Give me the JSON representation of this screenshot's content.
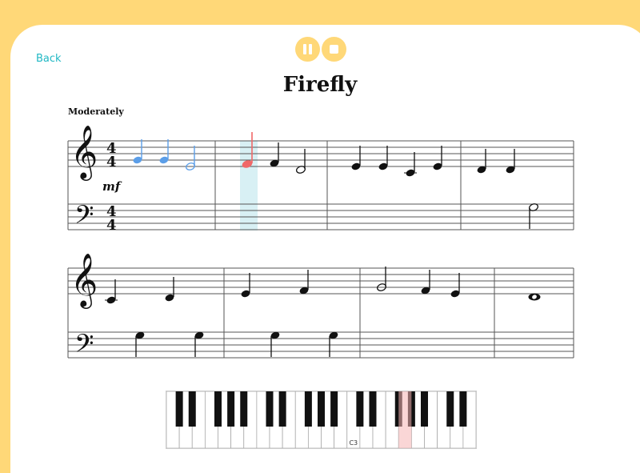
{
  "nav": {
    "back_label": "Back"
  },
  "controls": {
    "pause_icon": "pause-icon",
    "stop_icon": "stop-icon"
  },
  "piece": {
    "title": "Firefly",
    "tempo": "Moderately",
    "dynamic": "mf",
    "time_signature": {
      "top": "4",
      "bottom": "4"
    }
  },
  "colors": {
    "played_note": "#5b9ee8",
    "current_note": "#f06868",
    "highlight_column": "#d8f0f4",
    "accent": "#21b8c4",
    "background": "#ffd878"
  },
  "piano": {
    "marker_label": "C3",
    "pressed_key_color": "#f5b5b5"
  }
}
